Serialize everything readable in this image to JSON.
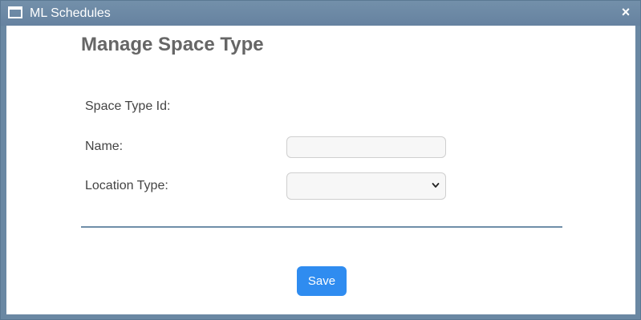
{
  "window": {
    "title": "ML Schedules",
    "close_label": "×",
    "title_bar_color": "#6a88a3"
  },
  "form": {
    "heading": "Manage Space Type",
    "fields": {
      "space_type_id": {
        "label": "Space Type Id:",
        "value": ""
      },
      "name": {
        "label": "Name:",
        "value": "",
        "placeholder": ""
      },
      "location_type": {
        "label": "Location Type:",
        "selected": ""
      }
    },
    "save_label": "Save",
    "accent_color": "#2f8cf0"
  },
  "icons": {
    "window": "window-icon",
    "close": "close-icon",
    "dropdown": "chevron-down-icon"
  }
}
